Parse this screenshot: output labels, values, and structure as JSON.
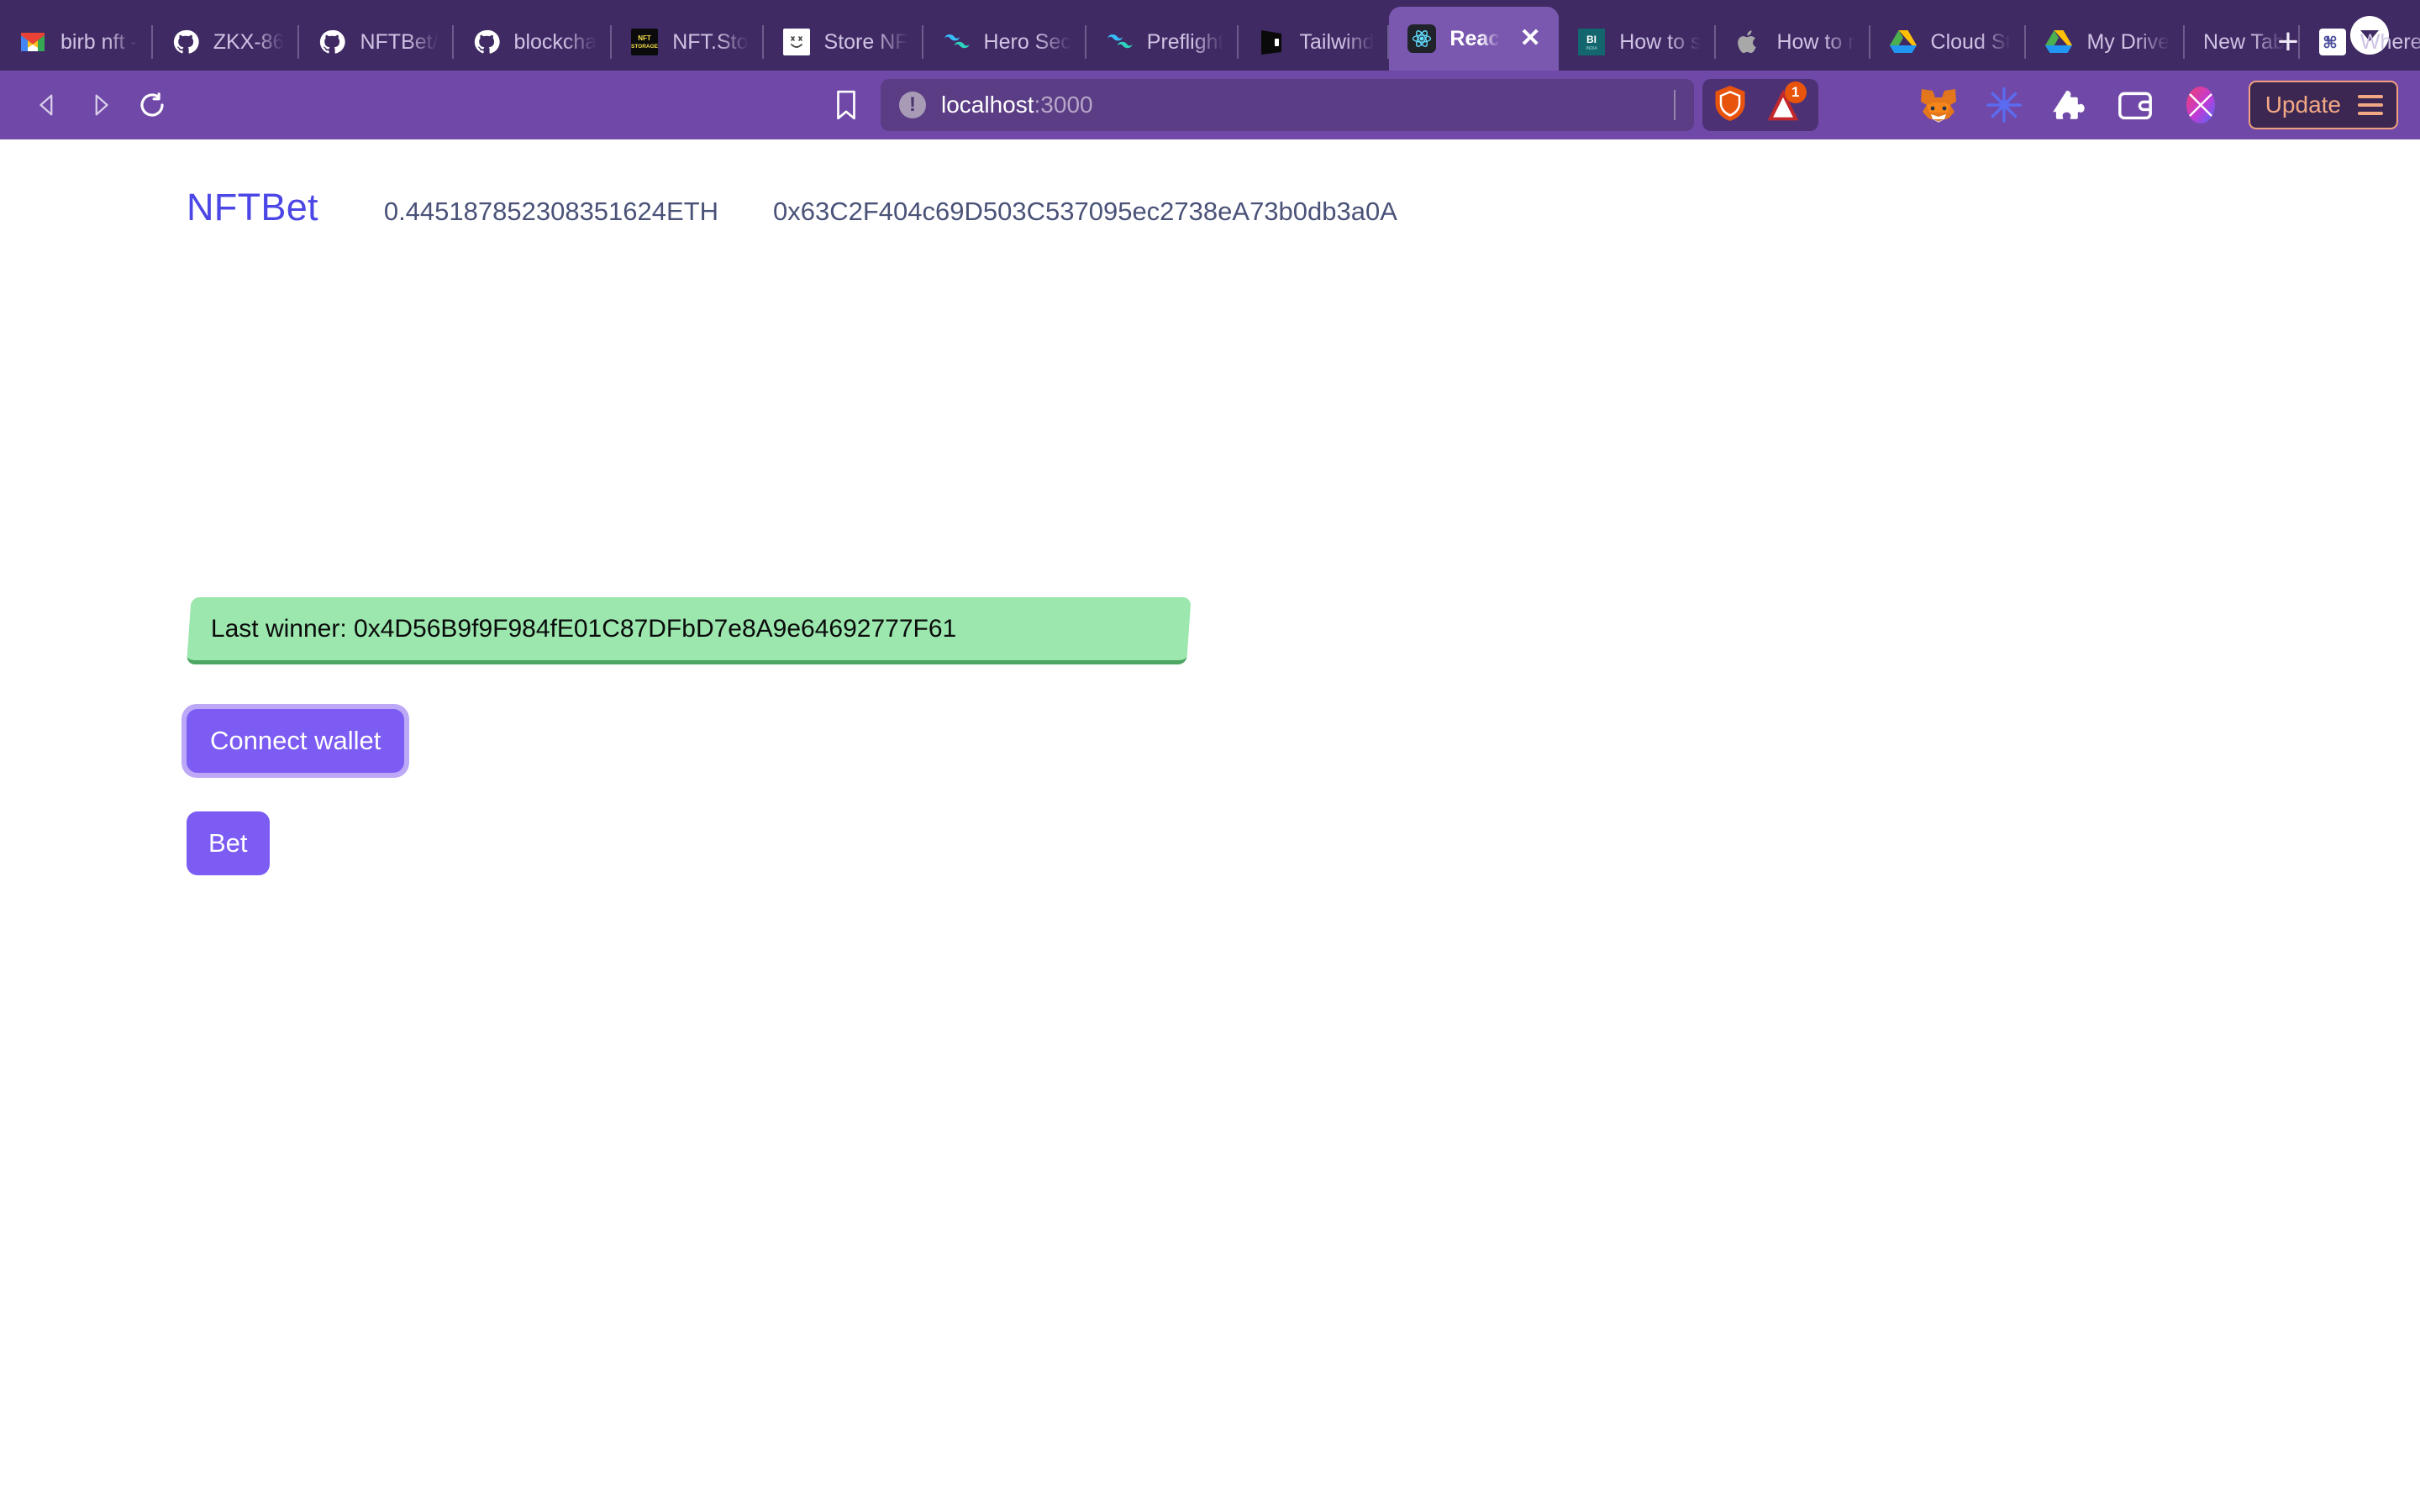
{
  "browser": {
    "tabs": [
      {
        "label": "birb nft -",
        "icon": "gmail-icon",
        "active": false
      },
      {
        "label": "ZKX-86",
        "icon": "github-icon",
        "active": false
      },
      {
        "label": "NFTBet/",
        "icon": "github-icon",
        "active": false
      },
      {
        "label": "blockcha",
        "icon": "github-icon",
        "active": false
      },
      {
        "label": "NFT.Sto",
        "icon": "nft-storage-icon",
        "active": false
      },
      {
        "label": "Store NF",
        "icon": "smiley-icon",
        "active": false
      },
      {
        "label": "Hero Sec",
        "icon": "tailwind-icon",
        "active": false
      },
      {
        "label": "Preflight",
        "icon": "tailwind-icon",
        "active": false
      },
      {
        "label": "Tailwind",
        "icon": "dark-book-icon",
        "active": false
      },
      {
        "label": "Reac",
        "icon": "react-icon",
        "active": true
      },
      {
        "label": "How to s",
        "icon": "bi-india-icon",
        "active": false
      },
      {
        "label": "How to r",
        "icon": "apple-icon",
        "active": false
      },
      {
        "label": "Cloud St",
        "icon": "google-drive-icon",
        "active": false
      },
      {
        "label": "My Drive",
        "icon": "google-drive-icon",
        "active": false
      },
      {
        "label": "New Tab",
        "icon": "none",
        "active": false
      },
      {
        "label": "Where d",
        "icon": "command-icon",
        "active": false
      }
    ],
    "new_tab_label": "+",
    "toolbar": {
      "back_icon": "back-arrow-icon",
      "forward_icon": "forward-arrow-icon",
      "reload_icon": "reload-icon",
      "bookmark_icon": "bookmark-icon",
      "url_host": "localhost",
      "url_port": ":3000",
      "security_icon": "not-secure-icon",
      "shield_icon": "brave-shield-icon",
      "badge_count": "1",
      "extensions": [
        "metamask-icon",
        "blue-burst-icon",
        "puzzle-piece-icon",
        "wallet-icon",
        "gradient-x-icon"
      ],
      "update_label": "Update",
      "menu_icon": "hamburger-menu-icon"
    }
  },
  "app": {
    "brand": "NFTBet",
    "balance": "0.445187852308351624ETH",
    "contract_address": "0x63C2F404c69D503C537095ec2738eA73b0db3a0A",
    "winner_banner": "Last winner: 0x4D56B9f9F984fE01C87DFbD7e8A9e64692777F61",
    "connect_wallet_label": "Connect wallet",
    "bet_label": "Bet",
    "colors": {
      "brand": "#4B46E5",
      "button": "#7C5CF3",
      "banner": "#9BE7AE",
      "chrome": "#7049A8"
    }
  }
}
